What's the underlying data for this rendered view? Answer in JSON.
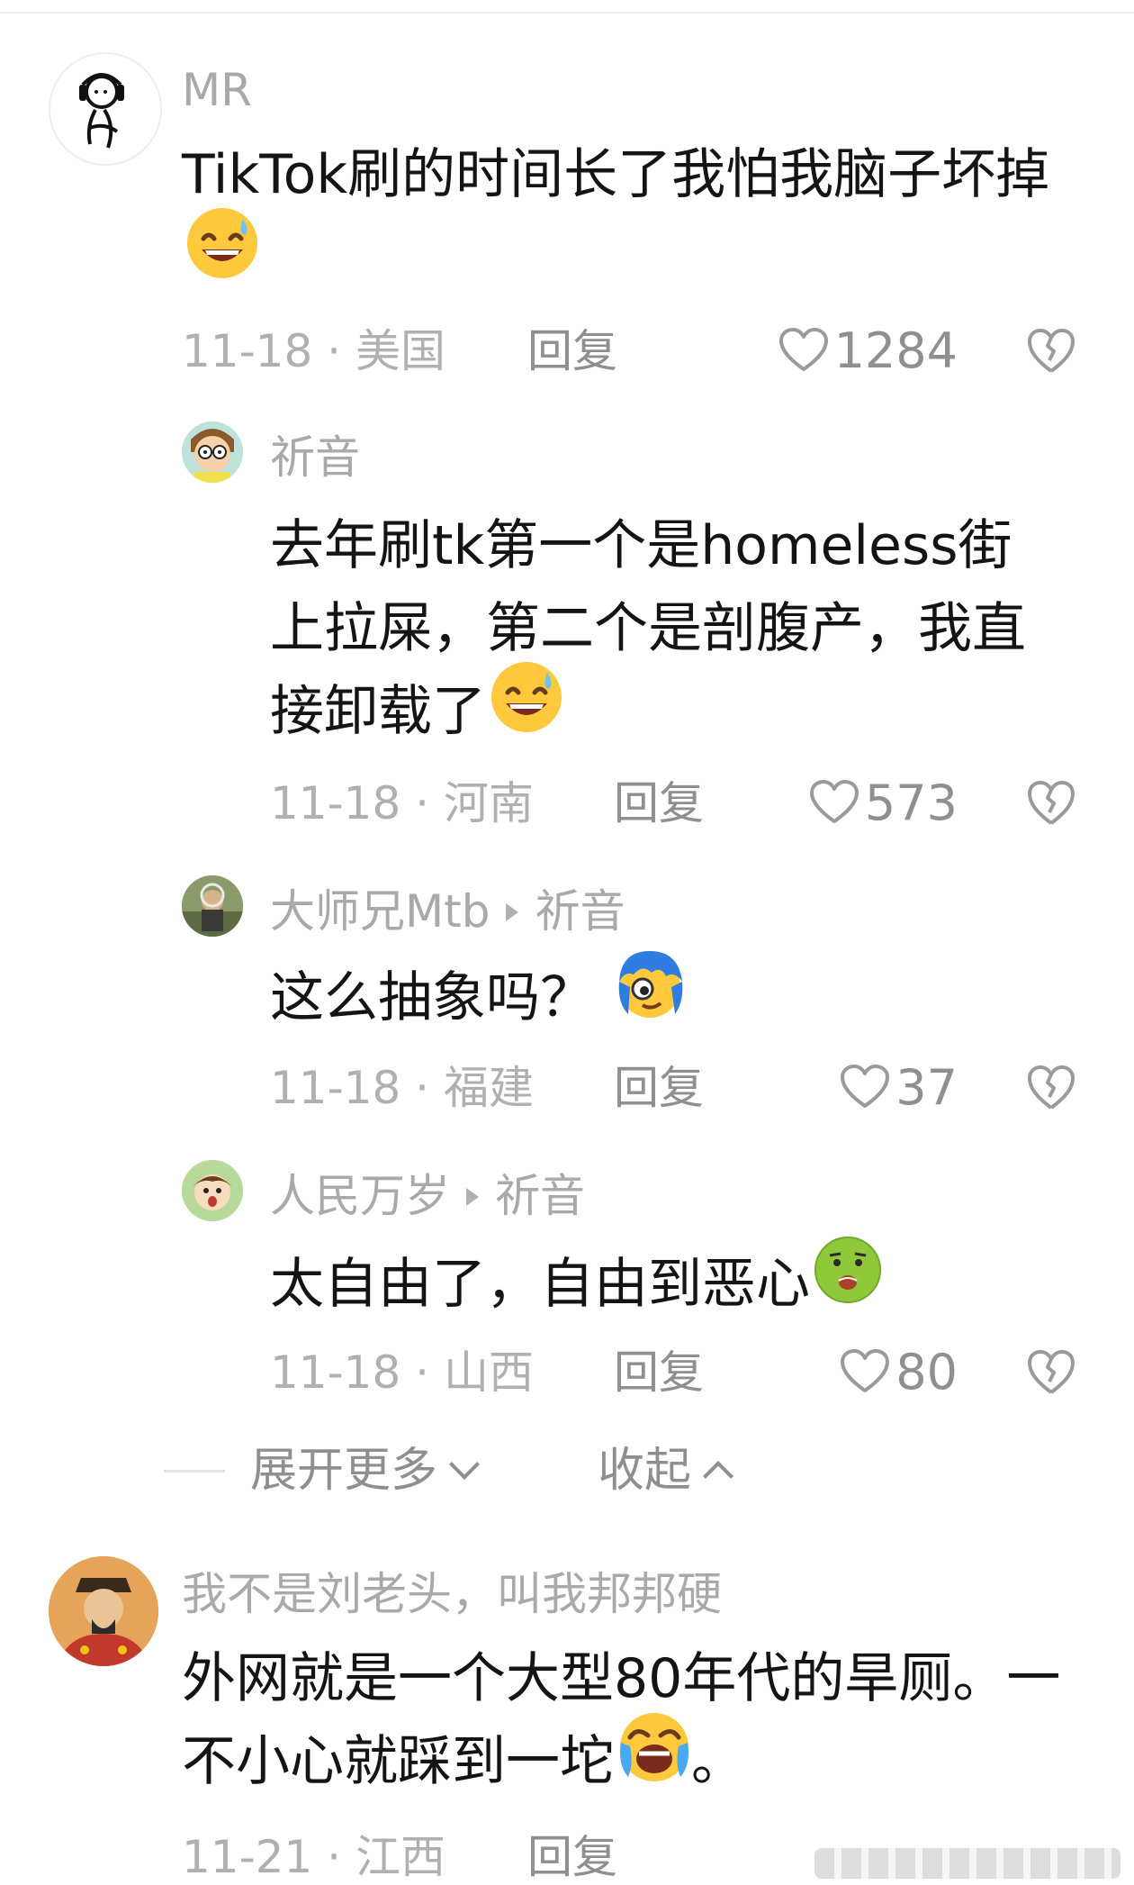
{
  "comments": [
    {
      "username": "MR",
      "text": "TikTok刷的时间长了我怕我脑子坏掉",
      "emoji": "grinning-sweat-emoji",
      "date_location": "11-18 · 美国",
      "reply_label": "回复",
      "likes": "1284"
    },
    {
      "username": "祈音",
      "text": "去年刷tk第一个是homeless街上拉屎，第二个是剖腹产，我直接卸载了",
      "emoji": "grinning-sweat-emoji",
      "date_location": "11-18 · 河南",
      "reply_label": "回复",
      "likes": "573"
    },
    {
      "username": "大师兄Mtb",
      "reply_to": "祈音",
      "text": "这么抽象吗？",
      "emoji": "blue-hair-face-emoji",
      "date_location": "11-18 · 福建",
      "reply_label": "回复",
      "likes": "37"
    },
    {
      "username": "人民万岁",
      "reply_to": "祈音",
      "text": "太自由了，自由到恶心",
      "emoji": "nauseated-face-emoji",
      "date_location": "11-18 · 山西",
      "reply_label": "回复",
      "likes": "80"
    },
    {
      "username": "我不是刘老头，叫我邦邦硬",
      "text": "外网就是一个大型80年代的旱厕。一不小心就踩到一坨",
      "text_suffix": "。",
      "emoji": "screaming-laughing-face-emoji",
      "date_location": "11-21 · 江西",
      "reply_label": "回复"
    }
  ],
  "expand": {
    "more_label": "展开更多",
    "collapse_label": "收起"
  },
  "colors": {
    "meta": "#b0b0b0",
    "text": "#141414",
    "action": "#8f8f8f",
    "emoji_yellow": "#ffc83d"
  }
}
